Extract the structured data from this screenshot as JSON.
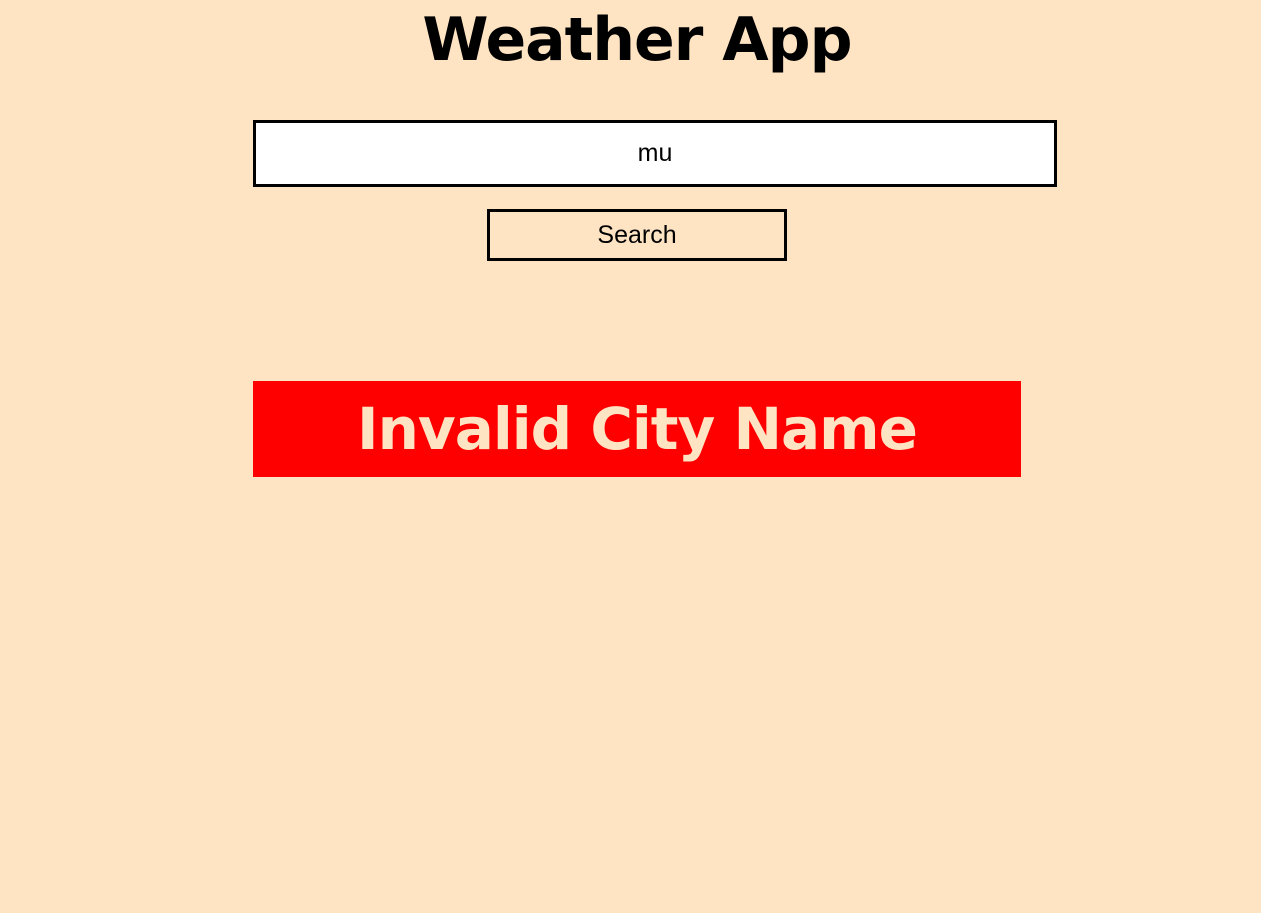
{
  "app": {
    "title": "Weather App"
  },
  "search": {
    "value": "mu",
    "button_label": "Search"
  },
  "error": {
    "message": "Invalid City Name"
  },
  "colors": {
    "background": "#ffe4c4",
    "error_background": "#ff0000",
    "error_text": "#ffe4c4"
  }
}
